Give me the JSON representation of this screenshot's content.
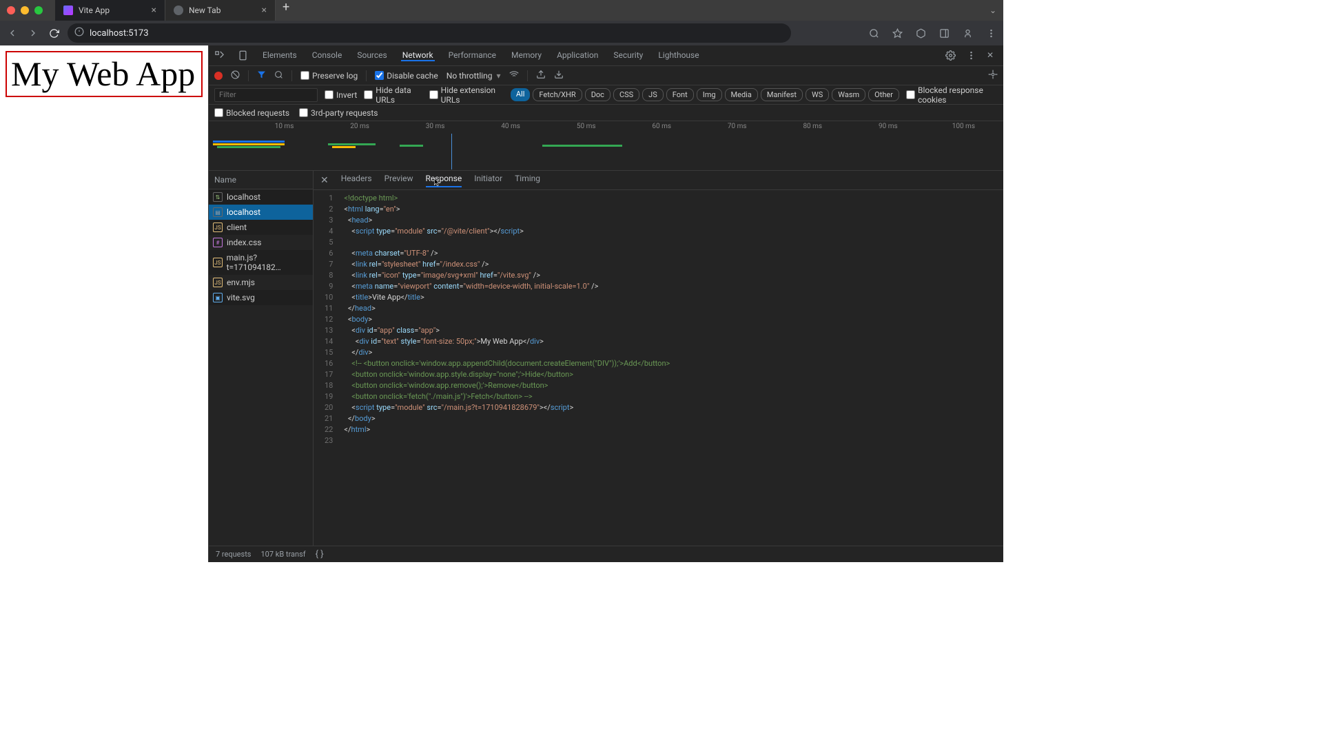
{
  "browser": {
    "tabs": [
      {
        "title": "Vite App"
      },
      {
        "title": "New Tab"
      }
    ],
    "url": "localhost:5173"
  },
  "page": {
    "heading": "My Web App"
  },
  "devtools": {
    "mainTabs": [
      "Elements",
      "Console",
      "Sources",
      "Network",
      "Performance",
      "Memory",
      "Application",
      "Security",
      "Lighthouse"
    ],
    "activeMainTab": "Network",
    "toolbar": {
      "preserveLog": "Preserve log",
      "disableCache": "Disable cache",
      "throttling": "No throttling"
    },
    "filterRow": {
      "filterPlaceholder": "Filter",
      "invert": "Invert",
      "hideDataUrls": "Hide data URLs",
      "hideExtUrls": "Hide extension URLs",
      "typePills": [
        "All",
        "Fetch/XHR",
        "Doc",
        "CSS",
        "JS",
        "Font",
        "Img",
        "Media",
        "Manifest",
        "WS",
        "Wasm",
        "Other"
      ],
      "activePill": "All",
      "blockedCookies": "Blocked response cookies"
    },
    "filterRow2": {
      "blockedRequests": "Blocked requests",
      "thirdParty": "3rd-party requests"
    },
    "timeline": {
      "ticks": [
        "10 ms",
        "20 ms",
        "30 ms",
        "40 ms",
        "50 ms",
        "60 ms",
        "70 ms",
        "80 ms",
        "90 ms",
        "100 ms"
      ]
    },
    "requests": {
      "header": "Name",
      "rows": [
        {
          "name": "localhost",
          "type": "ws"
        },
        {
          "name": "localhost",
          "type": "doc"
        },
        {
          "name": "client",
          "type": "js"
        },
        {
          "name": "index.css",
          "type": "css"
        },
        {
          "name": "main.js?t=171094182…",
          "type": "js"
        },
        {
          "name": "env.mjs",
          "type": "js"
        },
        {
          "name": "vite.svg",
          "type": "img"
        }
      ],
      "selectedIndex": 1
    },
    "detailTabs": [
      "Headers",
      "Preview",
      "Response",
      "Initiator",
      "Timing"
    ],
    "activeDetailTab": "Response",
    "response": {
      "lines": [
        [
          [
            "comment",
            "<!doctype html>"
          ]
        ],
        [
          [
            "punc",
            "<"
          ],
          [
            "tag",
            "html"
          ],
          [
            "punc",
            " "
          ],
          [
            "attr",
            "lang"
          ],
          [
            "punc",
            "="
          ],
          [
            "str",
            "\"en\""
          ],
          [
            "punc",
            ">"
          ]
        ],
        [
          [
            "punc",
            "  <"
          ],
          [
            "tag",
            "head"
          ],
          [
            "punc",
            ">"
          ]
        ],
        [
          [
            "punc",
            "    <"
          ],
          [
            "tag",
            "script"
          ],
          [
            "punc",
            " "
          ],
          [
            "attr",
            "type"
          ],
          [
            "punc",
            "="
          ],
          [
            "str",
            "\"module\""
          ],
          [
            "punc",
            " "
          ],
          [
            "attr",
            "src"
          ],
          [
            "punc",
            "="
          ],
          [
            "str",
            "\"/@vite/client\""
          ],
          [
            "punc",
            "></"
          ],
          [
            "tag",
            "script"
          ],
          [
            "punc",
            ">"
          ]
        ],
        [
          [
            "text",
            ""
          ]
        ],
        [
          [
            "punc",
            "    <"
          ],
          [
            "tag",
            "meta"
          ],
          [
            "punc",
            " "
          ],
          [
            "attr",
            "charset"
          ],
          [
            "punc",
            "="
          ],
          [
            "str",
            "\"UTF-8\""
          ],
          [
            "punc",
            " />"
          ]
        ],
        [
          [
            "punc",
            "    <"
          ],
          [
            "tag",
            "link"
          ],
          [
            "punc",
            " "
          ],
          [
            "attr",
            "rel"
          ],
          [
            "punc",
            "="
          ],
          [
            "str",
            "\"stylesheet\""
          ],
          [
            "punc",
            " "
          ],
          [
            "attr",
            "href"
          ],
          [
            "punc",
            "="
          ],
          [
            "str",
            "\"/index.css\""
          ],
          [
            "punc",
            " />"
          ]
        ],
        [
          [
            "punc",
            "    <"
          ],
          [
            "tag",
            "link"
          ],
          [
            "punc",
            " "
          ],
          [
            "attr",
            "rel"
          ],
          [
            "punc",
            "="
          ],
          [
            "str",
            "\"icon\""
          ],
          [
            "punc",
            " "
          ],
          [
            "attr",
            "type"
          ],
          [
            "punc",
            "="
          ],
          [
            "str",
            "\"image/svg+xml\""
          ],
          [
            "punc",
            " "
          ],
          [
            "attr",
            "href"
          ],
          [
            "punc",
            "="
          ],
          [
            "str",
            "\"/vite.svg\""
          ],
          [
            "punc",
            " />"
          ]
        ],
        [
          [
            "punc",
            "    <"
          ],
          [
            "tag",
            "meta"
          ],
          [
            "punc",
            " "
          ],
          [
            "attr",
            "name"
          ],
          [
            "punc",
            "="
          ],
          [
            "str",
            "\"viewport\""
          ],
          [
            "punc",
            " "
          ],
          [
            "attr",
            "content"
          ],
          [
            "punc",
            "="
          ],
          [
            "str",
            "\"width=device-width, initial-scale=1.0\""
          ],
          [
            "punc",
            " />"
          ]
        ],
        [
          [
            "punc",
            "    <"
          ],
          [
            "tag",
            "title"
          ],
          [
            "punc",
            ">"
          ],
          [
            "text",
            "Vite App"
          ],
          [
            "punc",
            "</"
          ],
          [
            "tag",
            "title"
          ],
          [
            "punc",
            ">"
          ]
        ],
        [
          [
            "punc",
            "  </"
          ],
          [
            "tag",
            "head"
          ],
          [
            "punc",
            ">"
          ]
        ],
        [
          [
            "punc",
            "  <"
          ],
          [
            "tag",
            "body"
          ],
          [
            "punc",
            ">"
          ]
        ],
        [
          [
            "punc",
            "    <"
          ],
          [
            "tag",
            "div"
          ],
          [
            "punc",
            " "
          ],
          [
            "attr",
            "id"
          ],
          [
            "punc",
            "="
          ],
          [
            "str",
            "\"app\""
          ],
          [
            "punc",
            " "
          ],
          [
            "attr",
            "class"
          ],
          [
            "punc",
            "="
          ],
          [
            "str",
            "\"app\""
          ],
          [
            "punc",
            ">"
          ]
        ],
        [
          [
            "punc",
            "      <"
          ],
          [
            "tag",
            "div"
          ],
          [
            "punc",
            " "
          ],
          [
            "attr",
            "id"
          ],
          [
            "punc",
            "="
          ],
          [
            "str",
            "\"text\""
          ],
          [
            "punc",
            " "
          ],
          [
            "attr",
            "style"
          ],
          [
            "punc",
            "="
          ],
          [
            "str",
            "\"font-size: 50px;\""
          ],
          [
            "punc",
            ">"
          ],
          [
            "text",
            "My Web App"
          ],
          [
            "punc",
            "</"
          ],
          [
            "tag",
            "div"
          ],
          [
            "punc",
            ">"
          ]
        ],
        [
          [
            "punc",
            "    </"
          ],
          [
            "tag",
            "div"
          ],
          [
            "punc",
            ">"
          ]
        ],
        [
          [
            "comment",
            "    <!-- <button onclick='window.app.appendChild(document.createElement(\"DIV\"));'>Add</button>"
          ]
        ],
        [
          [
            "comment",
            "    <button onclick='window.app.style.display=\"none\";'>Hide</button>"
          ]
        ],
        [
          [
            "comment",
            "    <button onclick='window.app.remove();'>Remove</button>"
          ]
        ],
        [
          [
            "comment",
            "    <button onclick='fetch(\"./main.js\")'>Fetch</button> -->"
          ]
        ],
        [
          [
            "punc",
            "    <"
          ],
          [
            "tag",
            "script"
          ],
          [
            "punc",
            " "
          ],
          [
            "attr",
            "type"
          ],
          [
            "punc",
            "="
          ],
          [
            "str",
            "\"module\""
          ],
          [
            "punc",
            " "
          ],
          [
            "attr",
            "src"
          ],
          [
            "punc",
            "="
          ],
          [
            "str",
            "\"/main.js?t=1710941828679\""
          ],
          [
            "punc",
            "></"
          ],
          [
            "tag",
            "script"
          ],
          [
            "punc",
            ">"
          ]
        ],
        [
          [
            "punc",
            "  </"
          ],
          [
            "tag",
            "body"
          ],
          [
            "punc",
            ">"
          ]
        ],
        [
          [
            "punc",
            "</"
          ],
          [
            "tag",
            "html"
          ],
          [
            "punc",
            ">"
          ]
        ],
        [
          [
            "text",
            ""
          ]
        ]
      ]
    },
    "status": {
      "requests": "7 requests",
      "transfer": "107 kB transf"
    }
  }
}
